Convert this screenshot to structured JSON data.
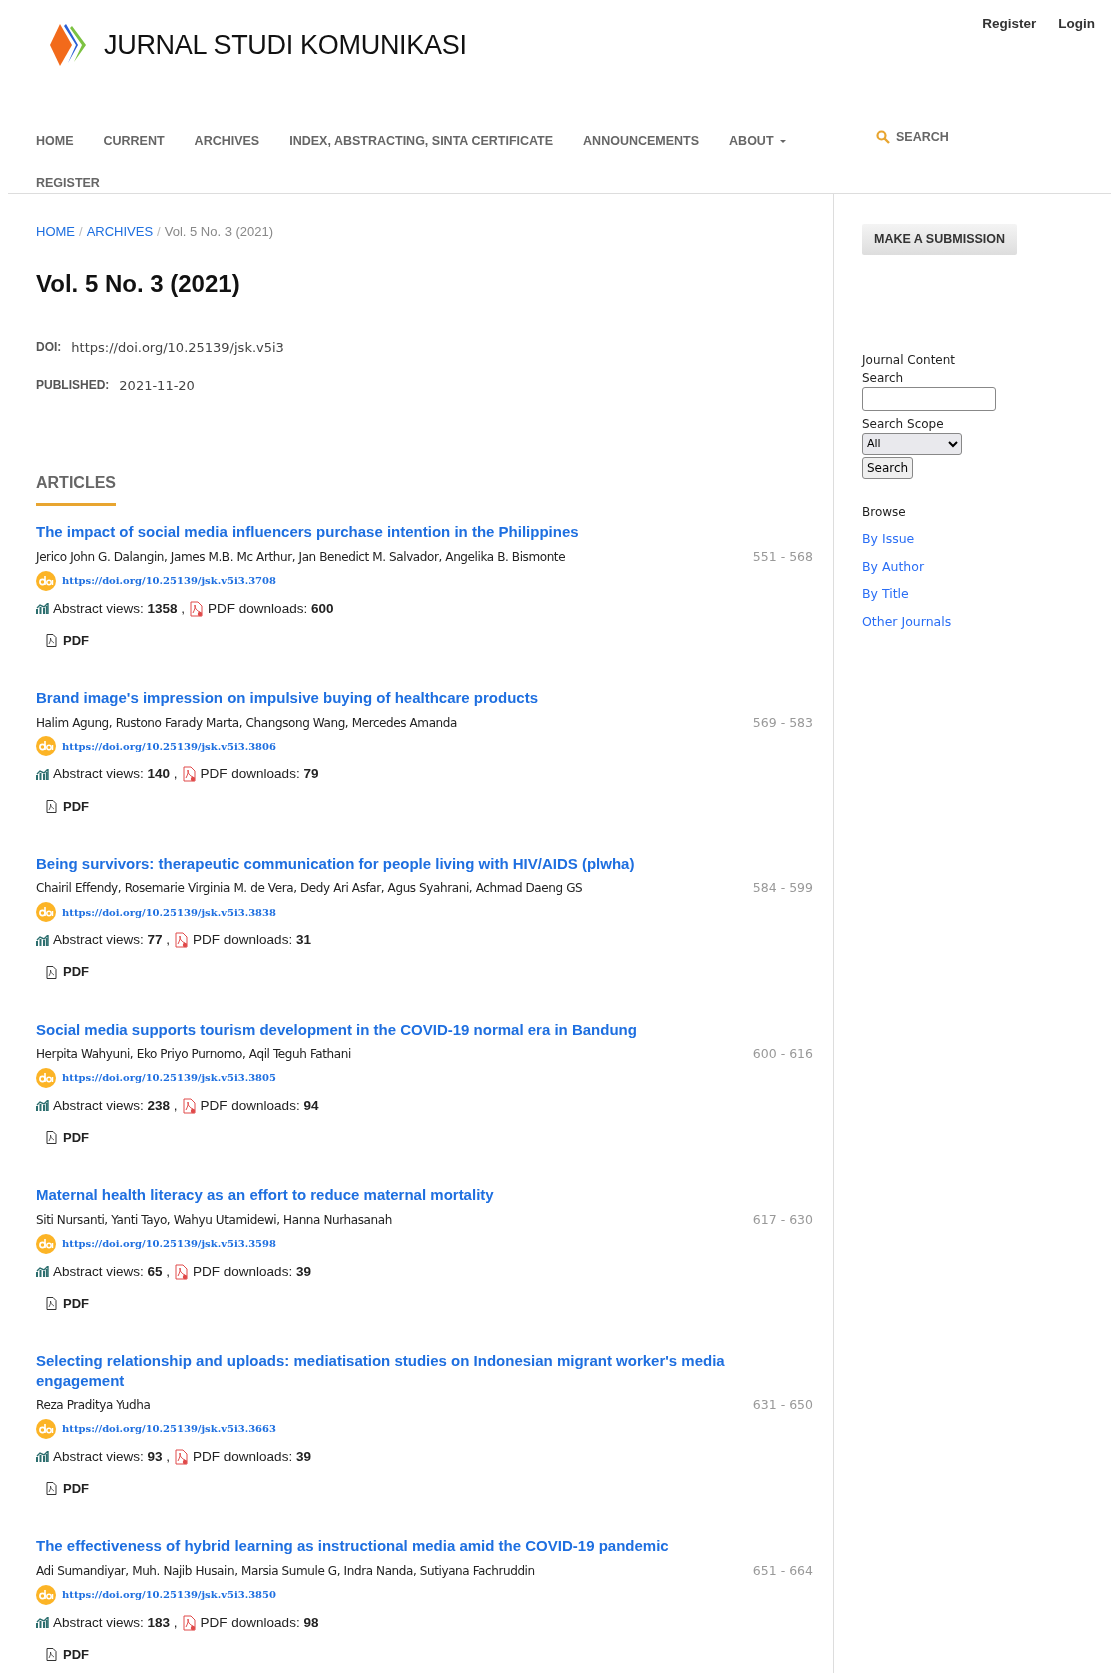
{
  "header": {
    "logo_text": "JURNAL STUDI KOMUNIKASI",
    "user_links": [
      "Register",
      "Login"
    ]
  },
  "nav": {
    "items": [
      {
        "label": "HOME",
        "has_dropdown": false
      },
      {
        "label": "CURRENT",
        "has_dropdown": false
      },
      {
        "label": "ARCHIVES",
        "has_dropdown": false
      },
      {
        "label": "INDEX, ABSTRACTING, SINTA CERTIFICATE",
        "has_dropdown": false
      },
      {
        "label": "ANNOUNCEMENTS",
        "has_dropdown": false
      },
      {
        "label": "ABOUT",
        "has_dropdown": true
      },
      {
        "label": "REGISTER",
        "has_dropdown": false
      }
    ],
    "search_label": "SEARCH"
  },
  "breadcrumb_separator": "/",
  "breadcrumb": [
    {
      "label": "HOME",
      "kind": "link"
    },
    {
      "label": "ARCHIVES",
      "kind": "link"
    },
    {
      "label": "Vol. 5 No. 3 (2021)",
      "kind": "current"
    }
  ],
  "issue": {
    "title": "Vol. 5 No. 3 (2021)",
    "doi_label": "DOI:",
    "doi": "https://doi.org/10.25139/jsk.v5i3",
    "published_label": "PUBLISHED:",
    "published": "2021-11-20"
  },
  "articles_heading": "ARTICLES",
  "articles": [
    {
      "title": "The impact of social media influencers purchase intention in the Philippines",
      "authors": "Jerico John G. Dalangin, James M.B. Mc Arthur, Jan Benedict M. Salvador, Angelika B. Bismonte",
      "pages": "551 - 568",
      "doi": "https://doi.org/10.25139/jsk.v5i3.3708",
      "views": "Abstract views: **1358** ,",
      "downloads": "PDF downloads: **600**",
      "galley": "PDF"
    },
    {
      "title": "Brand image's impression on impulsive buying of healthcare products",
      "authors": "Halim Agung, Rustono Farady Marta, Changsong Wang, Mercedes Amanda",
      "pages": "569 - 583",
      "doi": "https://doi.org/10.25139/jsk.v5i3.3806",
      "views": "Abstract views: **140** ,",
      "downloads": "PDF downloads: **79**",
      "galley": "PDF"
    },
    {
      "title": "Being survivors: therapeutic communication for people living with HIV/AIDS (plwha)",
      "authors": "Chairil Effendy, Rosemarie Virginia M. de Vera, Dedy Ari Asfar, Agus Syahrani, Achmad Daeng GS",
      "pages": "584 - 599",
      "doi": "https://doi.org/10.25139/jsk.v5i3.3838",
      "views": "Abstract views: **77** ,",
      "downloads": "PDF downloads: **31**",
      "galley": "PDF"
    },
    {
      "title": "Social media supports tourism development in the COVID-19 normal era in Bandung",
      "authors": "Herpita Wahyuni, Eko Priyo Purnomo, Aqil Teguh Fathani",
      "pages": "600 - 616",
      "doi": "https://doi.org/10.25139/jsk.v5i3.3805",
      "views": "Abstract views: **238** ,",
      "downloads": "PDF downloads: **94**",
      "galley": "PDF"
    },
    {
      "title": "Maternal health literacy as an effort to reduce maternal mortality",
      "authors": "Siti Nursanti, Yanti Tayo, Wahyu Utamidewi, Hanna Nurhasanah",
      "pages": "617 - 630",
      "doi": "https://doi.org/10.25139/jsk.v5i3.3598",
      "views": "Abstract views: **65** ,",
      "downloads": "PDF downloads: **39**",
      "galley": "PDF"
    },
    {
      "title": "Selecting relationship and uploads: mediatisation studies on Indonesian migrant worker's media engagement",
      "authors": "Reza Praditya Yudha",
      "pages": "631 - 650",
      "doi": "https://doi.org/10.25139/jsk.v5i3.3663",
      "views": "Abstract views: **93** ,",
      "downloads": "PDF downloads: **39**",
      "galley": "PDF"
    },
    {
      "title": "The effectiveness of hybrid learning as instructional media amid the COVID-19 pandemic",
      "authors": "Adi Sumandiyar, Muh. Najib Husain, Marsia Sumule G, Indra Nanda, Sutiyana Fachruddin",
      "pages": "651 - 664",
      "doi": "https://doi.org/10.25139/jsk.v5i3.3850",
      "views": "Abstract views: **183** ,",
      "downloads": "PDF downloads: **98**",
      "galley": "PDF"
    }
  ],
  "sidebar": {
    "submit_button": "MAKE A SUBMISSION",
    "search_title": "Journal Content",
    "search_label": "Search",
    "scope_label": "Search Scope",
    "scope_value": "All",
    "search_button": "Search",
    "browse_title": "Browse",
    "browse_links": [
      "By Issue",
      "By Author",
      "By Title",
      "Other Journals"
    ]
  }
}
